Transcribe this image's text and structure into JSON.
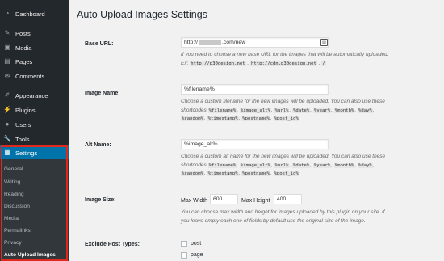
{
  "sidebar": {
    "items": [
      {
        "label": "Dashboard",
        "icon": "dashboard-icon"
      },
      {
        "label": "Posts",
        "icon": "pin-icon"
      },
      {
        "label": "Media",
        "icon": "media-icon"
      },
      {
        "label": "Pages",
        "icon": "page-icon"
      },
      {
        "label": "Comments",
        "icon": "comment-icon"
      },
      {
        "label": "Appearance",
        "icon": "brush-icon"
      },
      {
        "label": "Plugins",
        "icon": "plug-icon"
      },
      {
        "label": "Users",
        "icon": "user-icon"
      },
      {
        "label": "Tools",
        "icon": "wrench-icon"
      },
      {
        "label": "Settings",
        "icon": "settings-icon"
      }
    ],
    "submenu": [
      "General",
      "Writing",
      "Reading",
      "Discussion",
      "Media",
      "Permalinks",
      "Privacy",
      "Auto Upload Images"
    ]
  },
  "page": {
    "title": "Auto Upload Images Settings"
  },
  "form": {
    "base_url": {
      "label": "Base URL:",
      "value": "http://",
      "value_suffix": ".com/new",
      "desc_line1": "If you need to choose a new base URL for the images that will be automatically uploaded.",
      "desc_prefix": "Ex:",
      "ex1": "http://p30design.net",
      "ex2": "http://cdn.p30design.net",
      "ex3": "/"
    },
    "image_name": {
      "label": "Image Name:",
      "value": "%filename%",
      "desc_line1": "Choose a custom filename for the new images will be uploaded. You can also use these",
      "desc_prefix": "shortcodes",
      "codes_line1": [
        "%filename%",
        "%image_alt%",
        "%url%",
        "%date%",
        "%year%",
        "%month%",
        "%day%"
      ],
      "codes_line2": [
        "%random%",
        "%timestamp%",
        "%postname%",
        "%post_id%"
      ]
    },
    "alt_name": {
      "label": "Alt Name:",
      "value": "%image_alt%",
      "desc_line1": "Choose a custom alt name for the new images will be uploaded. You can also use these",
      "desc_prefix": "shortcodes",
      "codes_line1": [
        "%filename%",
        "%image_alt%",
        "%url%",
        "%date%",
        "%year%",
        "%month%",
        "%day%"
      ],
      "codes_line2": [
        "%random%",
        "%timestamp%",
        "%postname%",
        "%post_id%"
      ]
    },
    "image_size": {
      "label": "Image Size:",
      "max_width_label": "Max Width",
      "max_width_value": "600",
      "max_height_label": "Max Height",
      "max_height_value": "400",
      "desc_line1": "You can choose max width and height for images uploaded by this plugin on your site. If",
      "desc_line2": "you leave empty each one of fields by default use the original size of the image."
    },
    "exclude_post_types": {
      "label": "Exclude Post Types:",
      "options": [
        "post",
        "page"
      ]
    }
  }
}
